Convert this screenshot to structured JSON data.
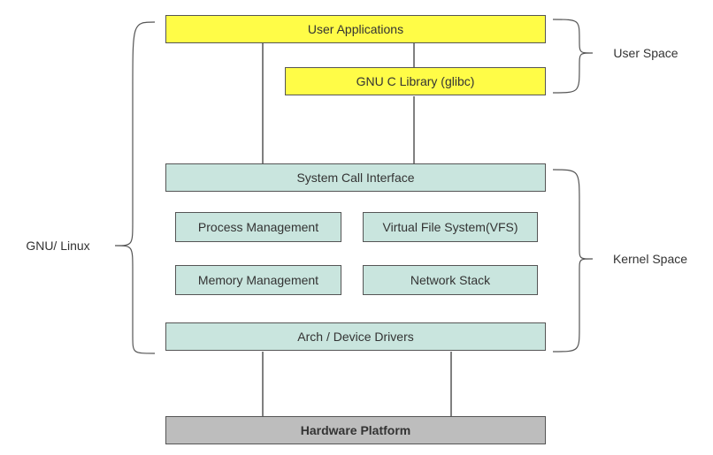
{
  "boxes": {
    "user_apps": "User Applications",
    "glibc": "GNU C Library (glibc)",
    "sci": "System Call Interface",
    "proc_mgmt": "Process Management",
    "vfs": "Virtual File System(VFS)",
    "mem_mgmt": "Memory Management",
    "net_stack": "Network Stack",
    "arch_drv": "Arch / Device Drivers",
    "hw": "Hardware Platform"
  },
  "labels": {
    "gnulinux": "GNU/ Linux",
    "user_space": "User Space",
    "kernel_space": "Kernel Space"
  }
}
